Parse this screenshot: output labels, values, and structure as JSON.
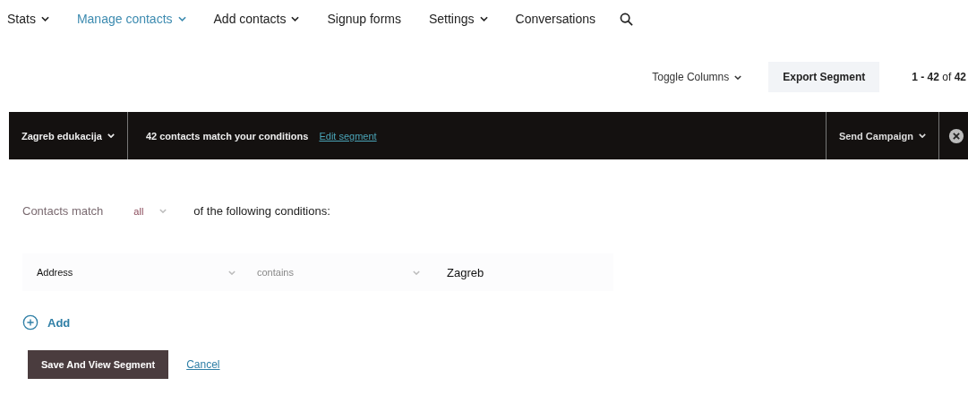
{
  "nav": [
    {
      "label": "Stats",
      "dropdown": true,
      "selected": false
    },
    {
      "label": "Manage contacts",
      "dropdown": true,
      "selected": true
    },
    {
      "label": "Add contacts",
      "dropdown": true,
      "selected": false
    },
    {
      "label": "Signup forms",
      "dropdown": false,
      "selected": false
    },
    {
      "label": "Settings",
      "dropdown": true,
      "selected": false
    },
    {
      "label": "Conversations",
      "dropdown": false,
      "selected": false
    }
  ],
  "toolbar": {
    "toggle_columns": "Toggle Columns",
    "export": "Export Segment",
    "range": "1 - 42",
    "range_of": "of",
    "total": "42"
  },
  "segment_bar": {
    "segment_name": "Zagreb edukacija",
    "match_text": "42 contacts match your conditions",
    "edit_link": "Edit segment",
    "send_campaign": "Send Campaign"
  },
  "conditions": {
    "prefix": "Contacts match",
    "match_mode": "all",
    "suffix": "of the following conditions:",
    "rows": [
      {
        "field": "Address",
        "operator": "contains",
        "value": "Zagreb"
      }
    ],
    "add": "Add",
    "save": "Save And View Segment",
    "cancel": "Cancel"
  }
}
